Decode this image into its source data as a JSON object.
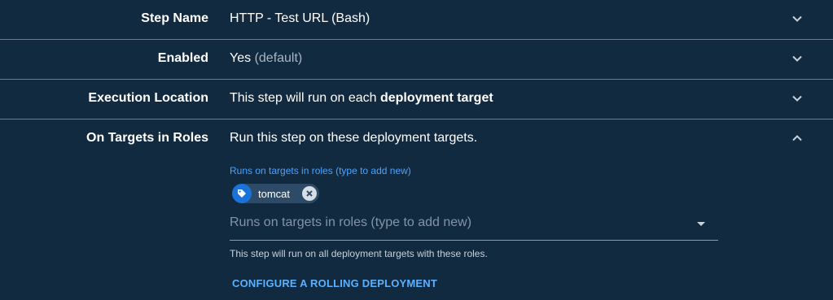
{
  "rows": [
    {
      "label": "Step Name",
      "value": "HTTP - Test URL (Bash)"
    },
    {
      "label": "Enabled",
      "value": "Yes",
      "value_muted": "(default)"
    },
    {
      "label": "Execution Location",
      "value": "This step will run on each ",
      "value_bold": "deployment target"
    },
    {
      "label": "On Targets in Roles",
      "value": "Run this step on these deployment targets."
    }
  ],
  "roles": {
    "field_label": "Runs on targets in roles (type to add new)",
    "chips": [
      {
        "label": "tomcat",
        "icon": "tag-icon"
      }
    ],
    "input_placeholder": "Runs on targets in roles (type to add new)",
    "helper_text": "This step will run on all deployment targets with these roles.",
    "rolling_link": "CONFIGURE A ROLLING DEPLOYMENT"
  },
  "colors": {
    "background": "#122a40",
    "accent": "#4aa3ff",
    "chip_tag": "#1a73d8"
  }
}
